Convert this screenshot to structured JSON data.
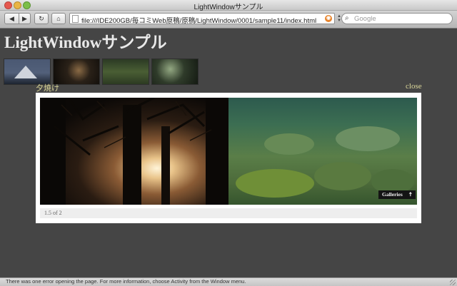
{
  "window": {
    "title": "LightWindowサンプル"
  },
  "toolbar": {
    "back_icon": "back-arrow-icon",
    "forward_icon": "forward-arrow-icon",
    "reload_icon": "reload-icon",
    "home_icon": "home-icon",
    "url": "file:///IDE200GB/毎コミWeb原稿/原稿/LightWindow/0001/sample11/index.html",
    "search_placeholder": "Google"
  },
  "page": {
    "heading": "LightWindowサンプル",
    "thumbnails": [
      "mountain-lake",
      "sunset-trees",
      "green-field",
      "waterfall"
    ]
  },
  "lightwindow": {
    "title": "夕焼け",
    "close_label": "close",
    "caption": "1.5 of 2",
    "galleries_label": "Galleries",
    "galleries_icon": "up-arrow-icon",
    "images": [
      "sunset-through-trees",
      "clear-water-over-rocks"
    ]
  },
  "statusbar": {
    "text": "There was one error opening the page. For more information, choose Activity from the Window menu."
  },
  "colors": {
    "page_background": "#454545",
    "link": "#dcd89a",
    "heading": "#e9e9e9"
  }
}
